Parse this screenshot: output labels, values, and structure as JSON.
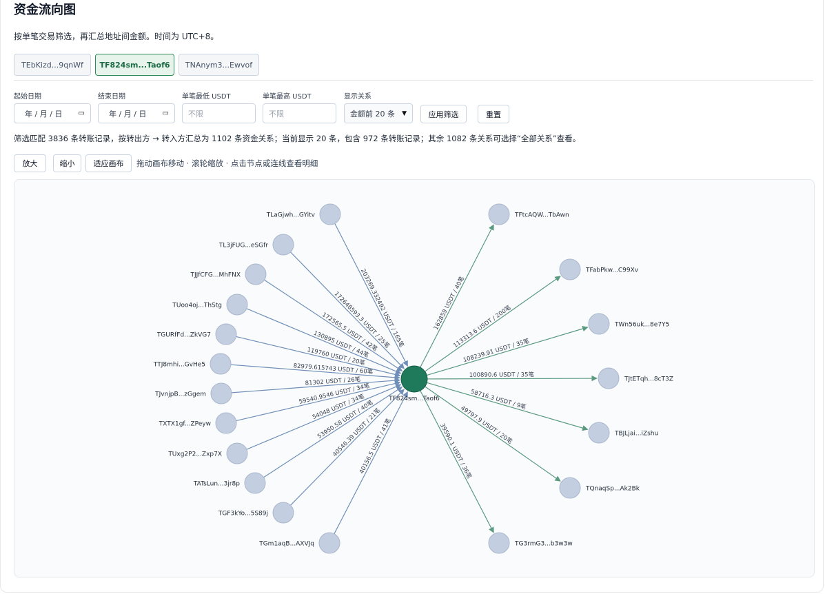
{
  "title": "资金流向图",
  "subtitle": "按单笔交易筛选，再汇总地址间金额。时间为 UTC+8。",
  "tabs": [
    {
      "label": "TEbKizd...9qnWf",
      "active": false
    },
    {
      "label": "TF824sm...Taof6",
      "active": true
    },
    {
      "label": "TNAnym3...Ewvof",
      "active": false
    }
  ],
  "filters": {
    "start_date_label": "起始日期",
    "start_date_value": "年 / 月 / 日",
    "end_date_label": "结束日期",
    "end_date_value": "年 / 月 / 日",
    "min_label": "单笔最低 USDT",
    "min_placeholder": "不限",
    "max_label": "单笔最高 USDT",
    "max_placeholder": "不限",
    "relation_label": "显示关系",
    "relation_value": "金额前 20 条",
    "apply_label": "应用筛选",
    "reset_label": "重置"
  },
  "summary": "筛选匹配 3836 条转账记录，按转出方 → 转入方汇总为 1102 条资金关系；当前显示 20 条，包含 972 条转账记录；其余 1082 条关系可选择“全部关系”查看。",
  "zoom": {
    "zoom_in": "放大",
    "zoom_out": "缩小",
    "fit": "适应画布",
    "hint": "拖动画布移动 · 滚轮缩放 · 点击节点或连线查看明细"
  },
  "graph": {
    "center": "TF824sm...Taof6",
    "colors": {
      "center": "#1f7a5c",
      "node": "#c3cee0",
      "in_edge": "#6f8fb8",
      "out_edge": "#5a9a80"
    },
    "inflows": [
      {
        "addr": "TLaGjwh...GYitv",
        "label": "203269.332492 USDT / 165笔"
      },
      {
        "addr": "TL3jFUG...eSGfr",
        "label": "172648593.3 USDT / 25笔"
      },
      {
        "addr": "TJJfCFG...MhFNX",
        "label": "172565.5 USDT / 42笔"
      },
      {
        "addr": "TUoo4oj...ThStg",
        "label": "130895 USDT / 44笔"
      },
      {
        "addr": "TGURfFd...ZkVG7",
        "label": "119760 USDT / 20笔"
      },
      {
        "addr": "TTJ8mhi...GvHe5",
        "label": "82979.615743 USDT / 60笔"
      },
      {
        "addr": "TJvnjpB...zGgem",
        "label": "81302 USDT / 26笔"
      },
      {
        "addr": "TXTX1gf...ZPeyw",
        "label": "59540.9546 USDT / 34笔"
      },
      {
        "addr": "TUxg2P2...Zxp7X",
        "label": "54048 USDT / 34笔"
      },
      {
        "addr": "TATsLun...3jr8p",
        "label": "53950.58 USDT / 40笔"
      },
      {
        "addr": "TGF3kYo...5S89j",
        "label": "40546.39 USDT / 21笔"
      },
      {
        "addr": "TGm1aqB...AXVJq",
        "label": "40156.5 USDT / 41笔"
      }
    ],
    "outflows": [
      {
        "addr": "TFtcAQW...TbAwn",
        "label": "162859 USDT / 40笔"
      },
      {
        "addr": "TFabPkw...C99Xv",
        "label": "113313.6 USDT / 200笔"
      },
      {
        "addr": "TWn56uk...8e7Y5",
        "label": "108239.91 USDT / 35笔"
      },
      {
        "addr": "TJtETqh...8cT3Z",
        "label": "100890.6 USDT / 35笔"
      },
      {
        "addr": "TBJLjai...iZshu",
        "label": "58716.3 USDT / 9笔"
      },
      {
        "addr": "TQnaqSp...Ak2Bk",
        "label": "49797.9 USDT / 20笔"
      },
      {
        "addr": "TG3rmG3...b3w3w",
        "label": "39590.1 USDT / 36笔"
      }
    ]
  }
}
